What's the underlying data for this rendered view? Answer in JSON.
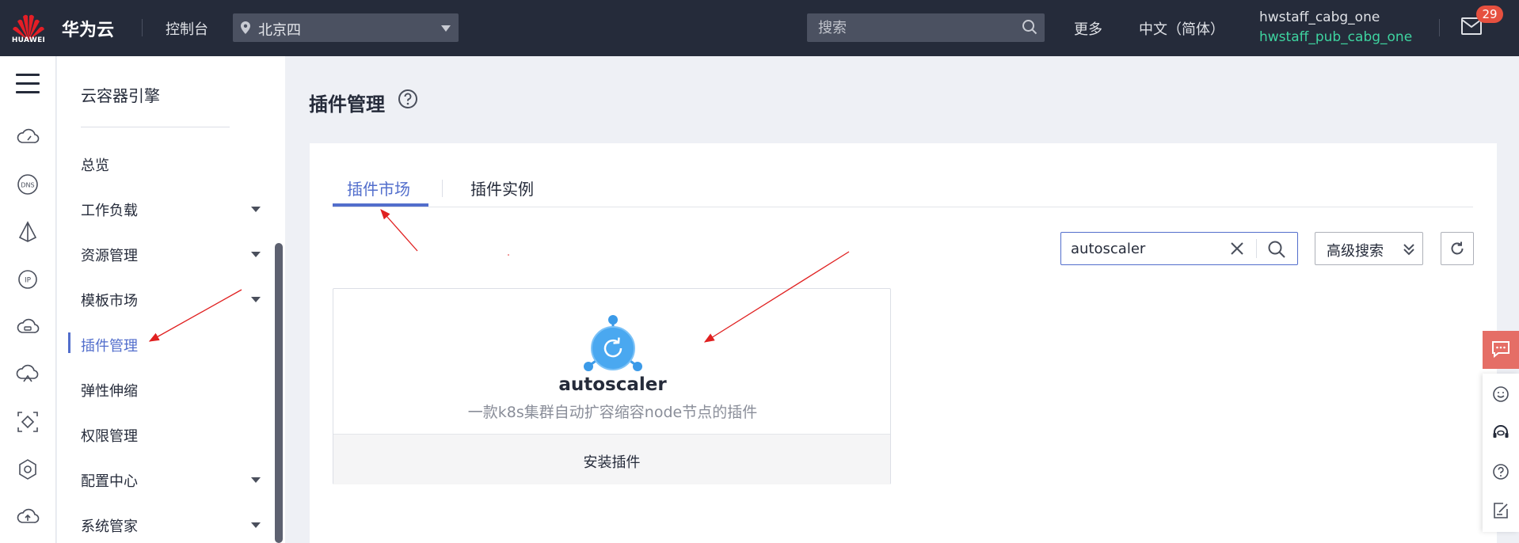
{
  "topbar": {
    "logo_text": "HUAWEI",
    "brand": "华为云",
    "console": "控制台",
    "region": "北京四",
    "search_placeholder": "搜索",
    "more": "更多",
    "language": "中文（简体）",
    "user_primary": "hwstaff_cabg_one",
    "user_secondary": "hwstaff_pub_cabg_one",
    "mail_badge": "29"
  },
  "rail": {
    "icons": [
      "cloud-speed-icon",
      "dns-icon",
      "delta-icon",
      "ip-icon",
      "cloud-storage-icon",
      "cloud-network-icon",
      "diamond-frame-icon",
      "hexagon-gear-icon",
      "cloud-upload-icon"
    ]
  },
  "sidebar": {
    "service_title": "云容器引擎",
    "items": [
      {
        "label": "总览",
        "has_arrow": false
      },
      {
        "label": "工作负载",
        "has_arrow": true
      },
      {
        "label": "资源管理",
        "has_arrow": true
      },
      {
        "label": "模板市场",
        "has_arrow": true
      },
      {
        "label": "插件管理",
        "has_arrow": false,
        "active": true
      },
      {
        "label": "弹性伸缩",
        "has_arrow": false
      },
      {
        "label": "权限管理",
        "has_arrow": false
      },
      {
        "label": "配置中心",
        "has_arrow": true
      },
      {
        "label": "系统管家",
        "has_arrow": true
      }
    ]
  },
  "main": {
    "page_title": "插件管理",
    "tabs": [
      {
        "label": "插件市场",
        "active": true
      },
      {
        "label": "插件实例",
        "active": false
      }
    ],
    "search_value": "autoscaler",
    "advanced_search": "高级搜索",
    "plugin": {
      "name": "autoscaler",
      "description": "一款k8s集群自动扩容缩容node节点的插件",
      "install": "安装插件"
    }
  },
  "colors": {
    "topbar_bg": "#252b3a",
    "accent": "#526ecc",
    "user_secondary": "#3ed4a0",
    "badge": "#e6503f",
    "chat_float": "#e56e66",
    "annotation_arrow": "#e02020"
  }
}
